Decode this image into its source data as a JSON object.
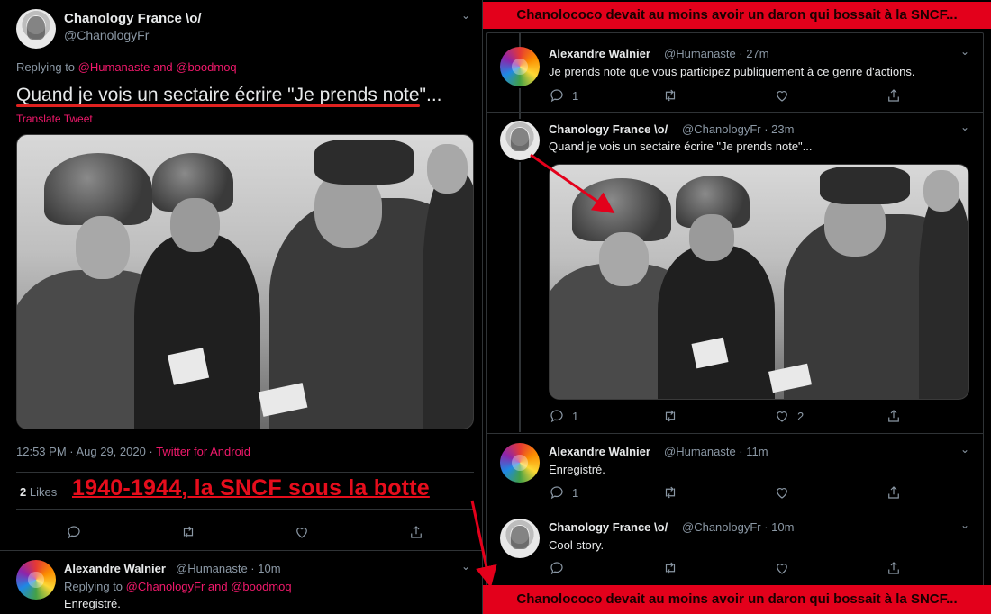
{
  "left_tweet": {
    "author_name": "Chanology France \\o/",
    "author_handle": "@ChanologyFr",
    "replying_prefix": "Replying to",
    "replying_users": "@Humanaste and @boodmoq",
    "text": "Quand je vois un sectaire écrire \"Je prends note\"...",
    "translate_label": "Translate Tweet",
    "timestamp": "12:53 PM · Aug 29, 2020 · ",
    "client": "Twitter for Android",
    "likes_count": "2",
    "likes_label": "Likes",
    "overlay_caption": "1940-1944, la SNCF sous la botte"
  },
  "left_reply": {
    "author_name": "Alexandre Walnier",
    "author_handle": "@Humanaste · 10m",
    "replying_prefix": "Replying to",
    "replying_users": "@ChanologyFr and @boodmoq",
    "text": "Enregistré."
  },
  "banner_top": "Chanolococo devait au moins avoir un daron qui bossait à la SNCF...",
  "banner_bottom": "Chanolococo devait au moins avoir un daron qui bossait à la SNCF...",
  "thread": [
    {
      "author_name": "Alexandre Walnier",
      "author_handle": "@Humanaste · 27m",
      "text": "Je prends note que vous participez publiquement à ce genre d'actions.",
      "reply_count": "1",
      "like_count": ""
    },
    {
      "author_name": "Chanology France \\o/",
      "author_handle": "@ChanologyFr · 23m",
      "text": "Quand je vois un sectaire écrire \"Je prends note\"...",
      "reply_count": "1",
      "like_count": "2"
    },
    {
      "author_name": "Alexandre Walnier",
      "author_handle": "@Humanaste · 11m",
      "text": "Enregistré.",
      "reply_count": "1",
      "like_count": ""
    },
    {
      "author_name": "Chanology France \\o/",
      "author_handle": "@ChanologyFr · 10m",
      "text": "Cool story.",
      "reply_count": "",
      "like_count": ""
    }
  ],
  "icons": [
    "reply-icon",
    "retweet-icon",
    "like-icon",
    "share-icon",
    "chevron-down-icon"
  ],
  "colors": {
    "accent_pink": "#f0196b",
    "annotation_red": "#e3001b",
    "background": "#000000",
    "muted_text": "#8b98a5"
  }
}
